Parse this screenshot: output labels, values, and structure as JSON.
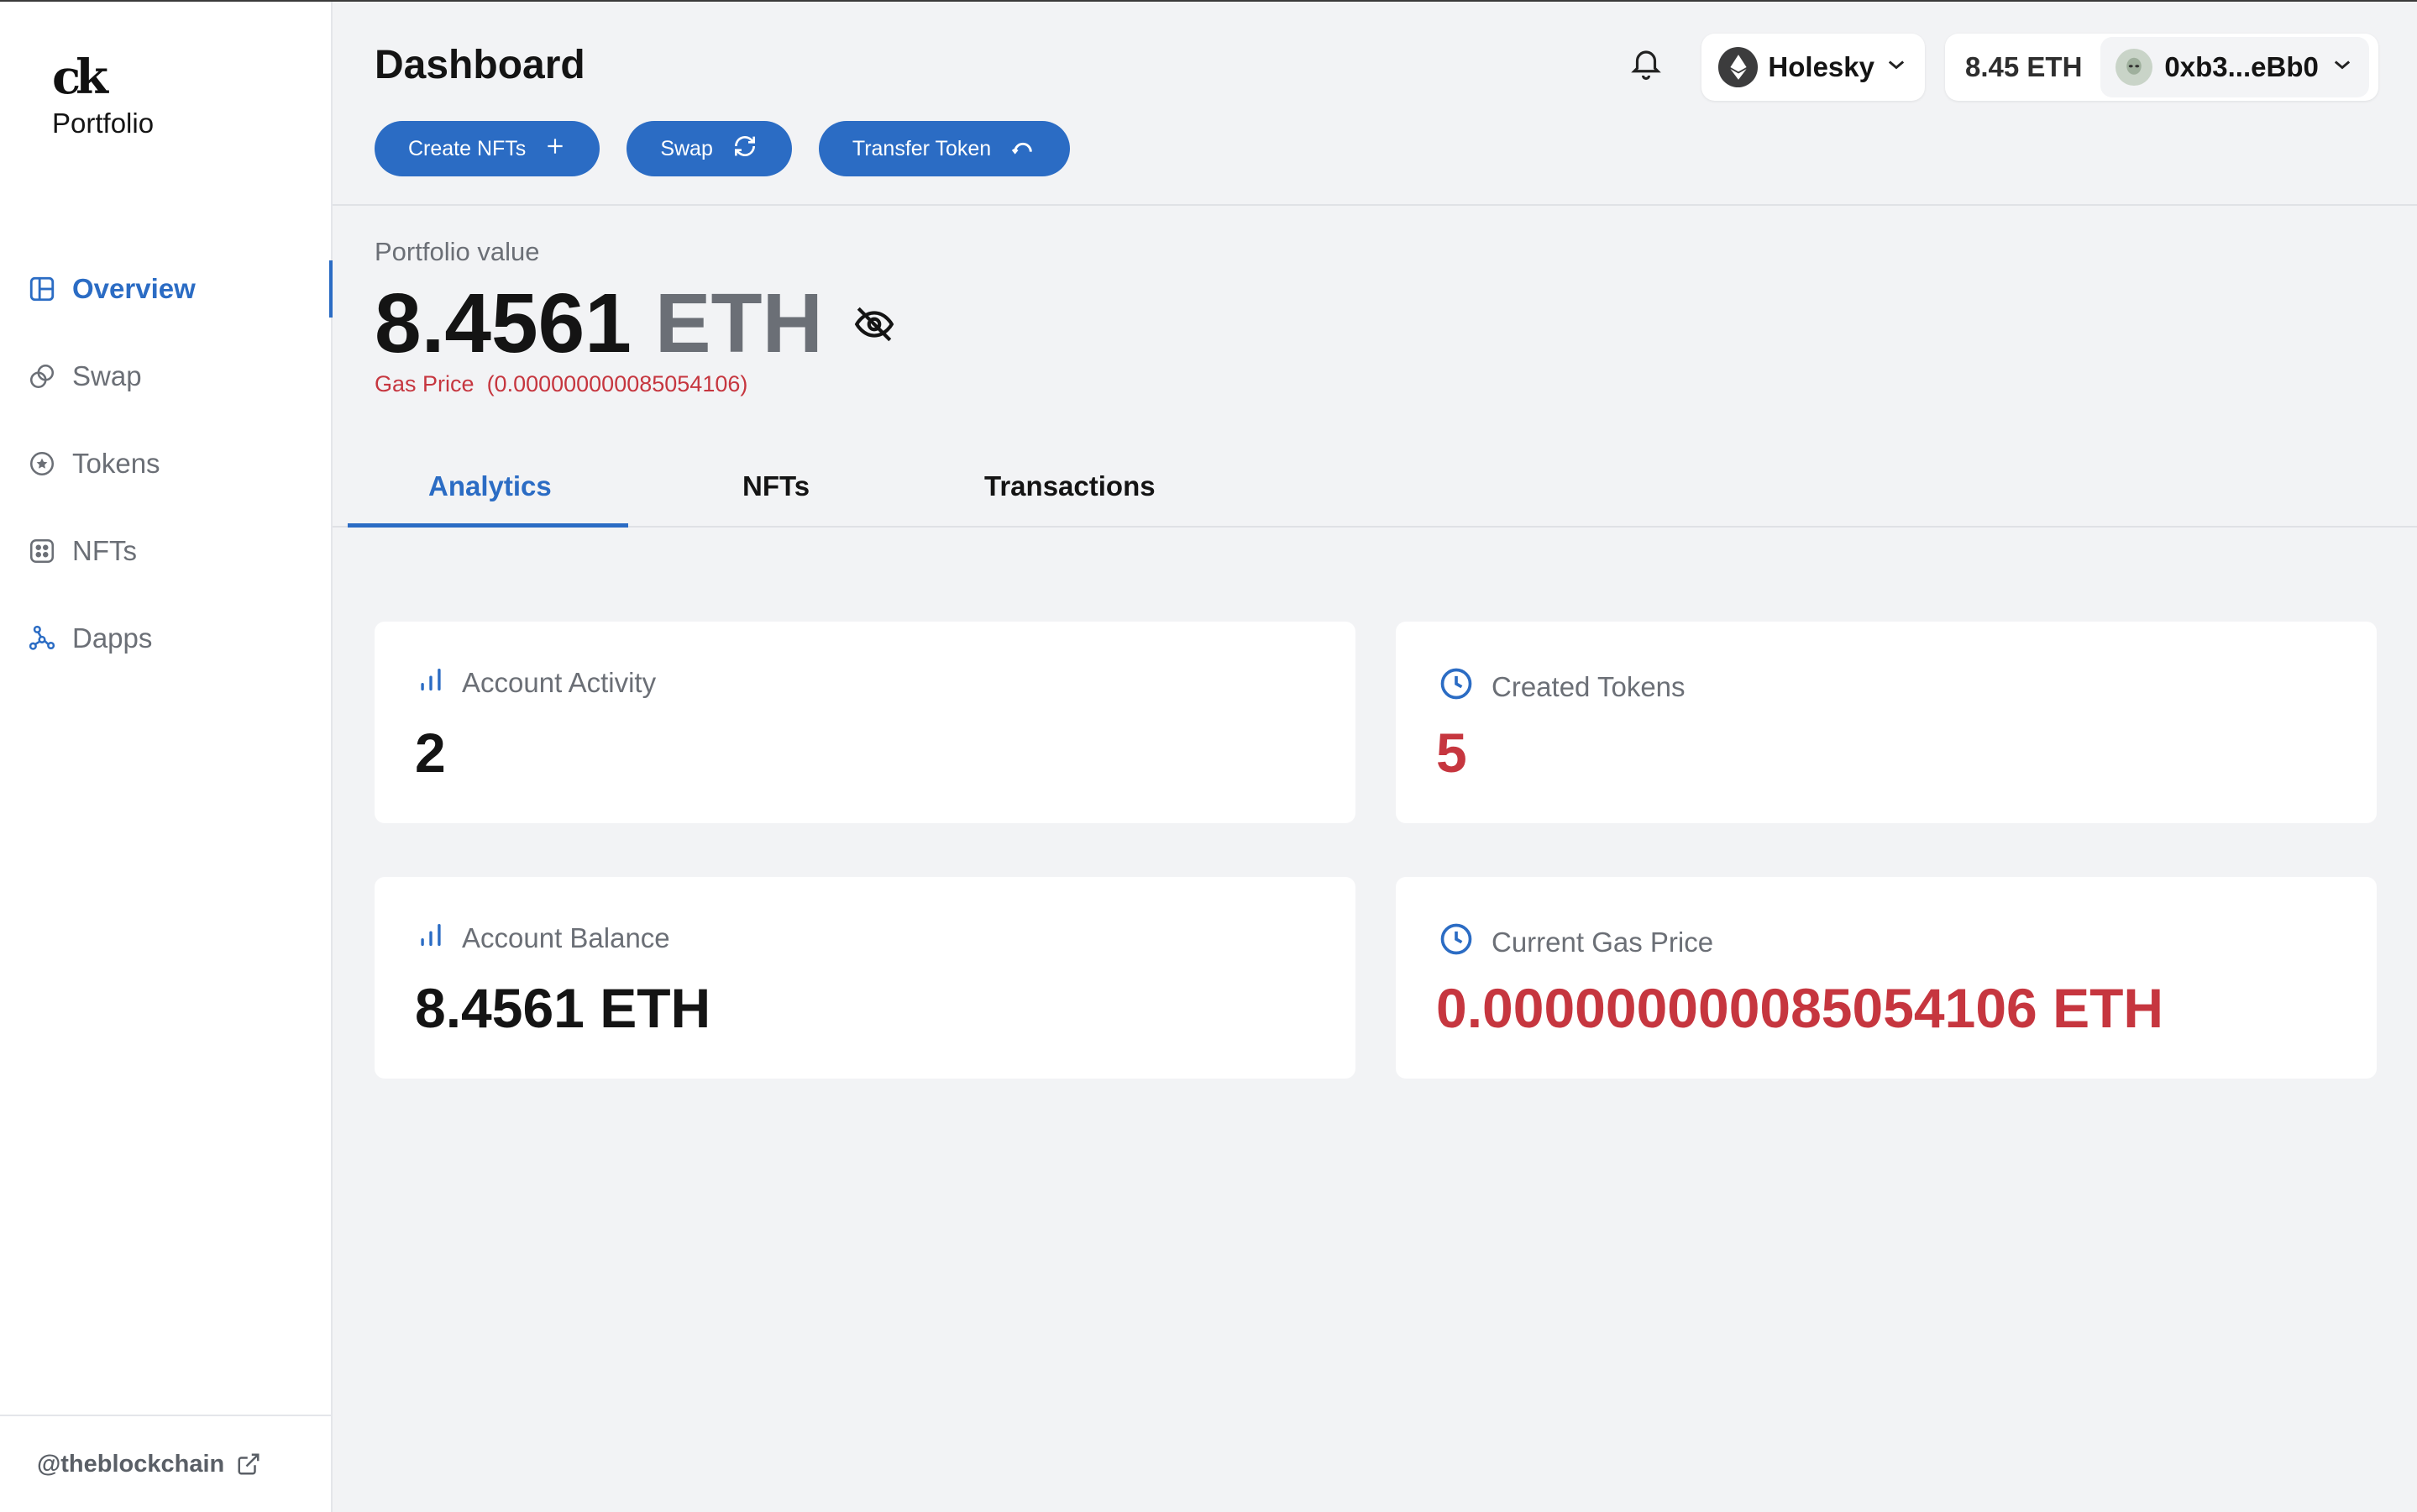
{
  "brand": {
    "mark": "ck",
    "name": "Portfolio"
  },
  "sidebar": {
    "items": [
      {
        "label": "Overview",
        "icon": "layout-icon",
        "active": true
      },
      {
        "label": "Swap",
        "icon": "swap-circles-icon",
        "active": false
      },
      {
        "label": "Tokens",
        "icon": "token-star-icon",
        "active": false
      },
      {
        "label": "NFTs",
        "icon": "nft-grid-icon",
        "active": false
      },
      {
        "label": "Dapps",
        "icon": "dapps-nodes-icon",
        "active": false
      }
    ],
    "footer_handle": "@theblockchain"
  },
  "header": {
    "title": "Dashboard",
    "actions": [
      {
        "label": "Create NFTs",
        "icon": "plus-icon"
      },
      {
        "label": "Swap",
        "icon": "refresh-icon"
      },
      {
        "label": "Transfer Token",
        "icon": "transfer-arc-icon"
      }
    ],
    "network": "Holesky",
    "balance": "8.45 ETH",
    "account": "0xb3...eBb0"
  },
  "portfolio": {
    "label": "Portfolio value",
    "amount": "8.4561",
    "unit": "ETH",
    "gas_label": "Gas Price",
    "gas_value": "(0.000000000085054106)"
  },
  "tabs": [
    {
      "label": "Analytics",
      "active": true
    },
    {
      "label": "NFTs",
      "active": false
    },
    {
      "label": "Transactions",
      "active": false
    }
  ],
  "cards": [
    {
      "title": "Account Activity",
      "value": "2",
      "icon": "bar-chart-icon"
    },
    {
      "title": "Created Tokens",
      "value": "5",
      "icon": "clock-icon"
    },
    {
      "title": "Account Balance",
      "value": "8.4561 ETH",
      "icon": "bar-chart-icon"
    },
    {
      "title": "Current Gas Price",
      "value": "0.000000000085054106 ETH",
      "icon": "clock-icon"
    }
  ],
  "colors": {
    "accent": "#2b6cc4",
    "danger": "#c6363f",
    "background": "#f2f3f5"
  }
}
